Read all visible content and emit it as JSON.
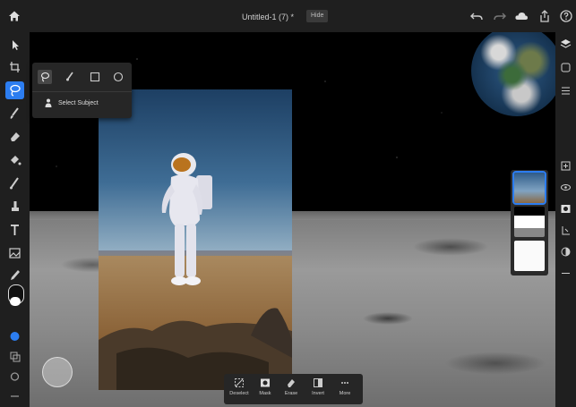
{
  "header": {
    "document_title": "Untitled-1 (7) *",
    "badge": "Hide"
  },
  "popover": {
    "subject_label": "Select Subject"
  },
  "taskbar": {
    "items": [
      {
        "label": "Deselect"
      },
      {
        "label": "Mask"
      },
      {
        "label": "Erase"
      },
      {
        "label": "Invert"
      },
      {
        "label": "More"
      }
    ]
  },
  "colors": {
    "accent": "#2c7df0",
    "panel": "#1f1f1f",
    "popover": "#262626"
  }
}
